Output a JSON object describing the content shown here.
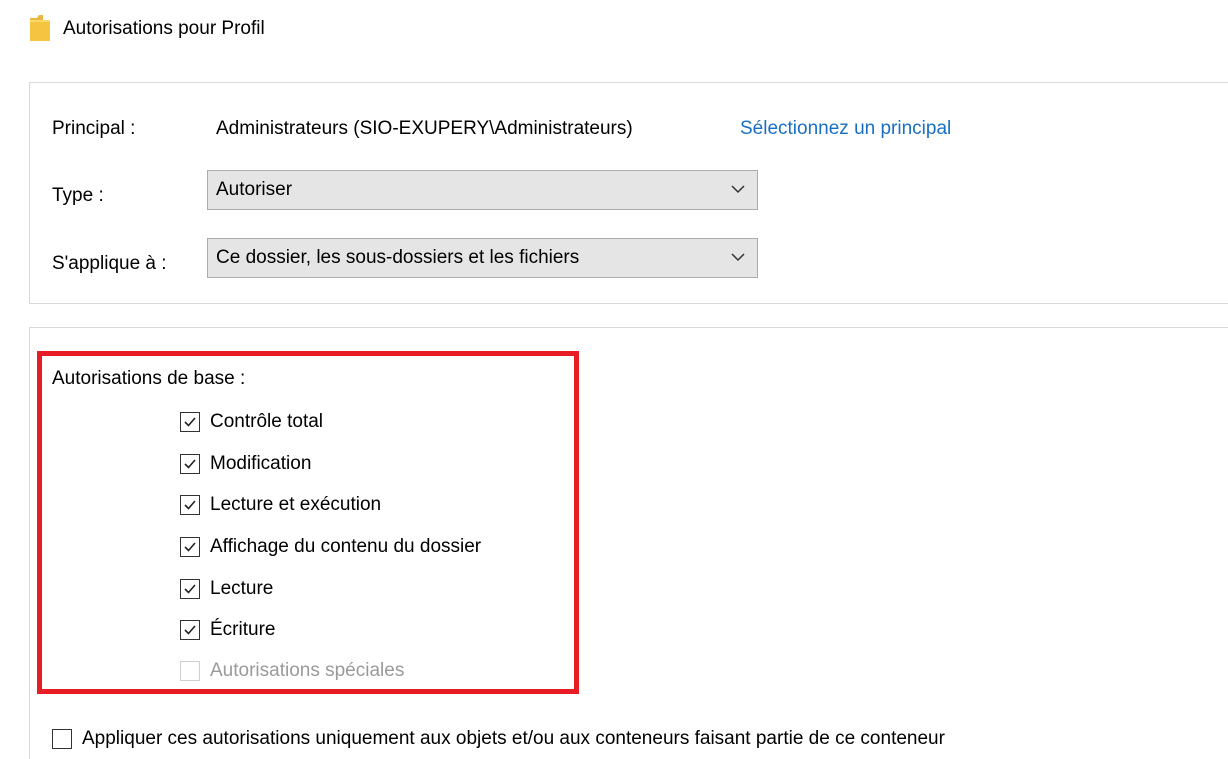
{
  "window": {
    "title": "Autorisations pour Profil",
    "icon": "folder-icon"
  },
  "principal": {
    "label": "Principal :",
    "value": "Administrateurs (SIO-EXUPERY\\Administrateurs)",
    "link": "Sélectionnez un principal"
  },
  "type": {
    "label": "Type :",
    "selected": "Autoriser",
    "icon": "chevron-down-icon"
  },
  "applies_to": {
    "label": "S'applique à :",
    "selected": "Ce dossier, les sous-dossiers et les fichiers",
    "icon": "chevron-down-icon"
  },
  "basic_permissions": {
    "label": "Autorisations de base :",
    "highlight_color": "#e81c24",
    "items": [
      {
        "label": "Contrôle total",
        "checked": true,
        "enabled": true
      },
      {
        "label": "Modification",
        "checked": true,
        "enabled": true
      },
      {
        "label": "Lecture et exécution",
        "checked": true,
        "enabled": true
      },
      {
        "label": "Affichage du contenu du dossier",
        "checked": true,
        "enabled": true
      },
      {
        "label": "Lecture",
        "checked": true,
        "enabled": true
      },
      {
        "label": "Écriture",
        "checked": true,
        "enabled": true
      },
      {
        "label": "Autorisations spéciales",
        "checked": false,
        "enabled": false
      }
    ]
  },
  "apply_only": {
    "label": "Appliquer ces autorisations uniquement aux objets et/ou aux conteneurs faisant partie de ce conteneur",
    "checked": false
  },
  "colors": {
    "link": "#1a6fc4",
    "dropdown_bg": "#e5e5e5",
    "folder": "#f5c542"
  }
}
